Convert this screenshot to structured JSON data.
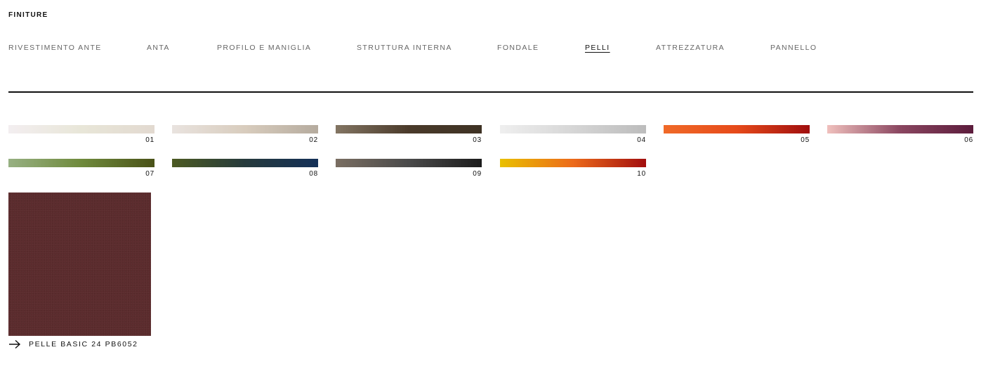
{
  "section_title": "FINITURE",
  "tabs": [
    {
      "label": "RIVESTIMENTO ANTE",
      "active": false
    },
    {
      "label": "ANTA",
      "active": false
    },
    {
      "label": "PROFILO E MANIGLIA",
      "active": false
    },
    {
      "label": "STRUTTURA INTERNA",
      "active": false
    },
    {
      "label": "FONDALE",
      "active": false
    },
    {
      "label": "PELLI",
      "active": true
    },
    {
      "label": "ATTREZZATURA",
      "active": false
    },
    {
      "label": "PANNELLO",
      "active": false
    }
  ],
  "swatches": [
    {
      "number": "01",
      "colors": [
        "#f3eef0",
        "#e8e6d8",
        "#e2d9d0"
      ]
    },
    {
      "number": "02",
      "colors": [
        "#e9e3df",
        "#d8ccbd",
        "#b5ab9e"
      ]
    },
    {
      "number": "03",
      "colors": [
        "#837563",
        "#4a3a2a",
        "#3e3224"
      ]
    },
    {
      "number": "04",
      "colors": [
        "#efefef",
        "#d6d6d6",
        "#bcbcbc"
      ]
    },
    {
      "number": "05",
      "colors": [
        "#f06a28",
        "#e64a1a",
        "#a00e0e"
      ]
    },
    {
      "number": "06",
      "colors": [
        "#f0c0bd",
        "#8a4660",
        "#5c1c3c"
      ]
    },
    {
      "number": "07",
      "colors": [
        "#97b082",
        "#6f8a3c",
        "#4a5218"
      ]
    },
    {
      "number": "08",
      "colors": [
        "#4c5a22",
        "#263a3c",
        "#143058"
      ]
    },
    {
      "number": "09",
      "colors": [
        "#7a6e62",
        "#4a4a4a",
        "#1c1c1c"
      ]
    },
    {
      "number": "10",
      "colors": [
        "#e9c000",
        "#ec6a1a",
        "#a20e0e"
      ]
    }
  ],
  "selected": {
    "label": "PELLE BASIC 24 PB6052",
    "color": "#5a2a2c",
    "icon": "arrow-right-icon"
  }
}
